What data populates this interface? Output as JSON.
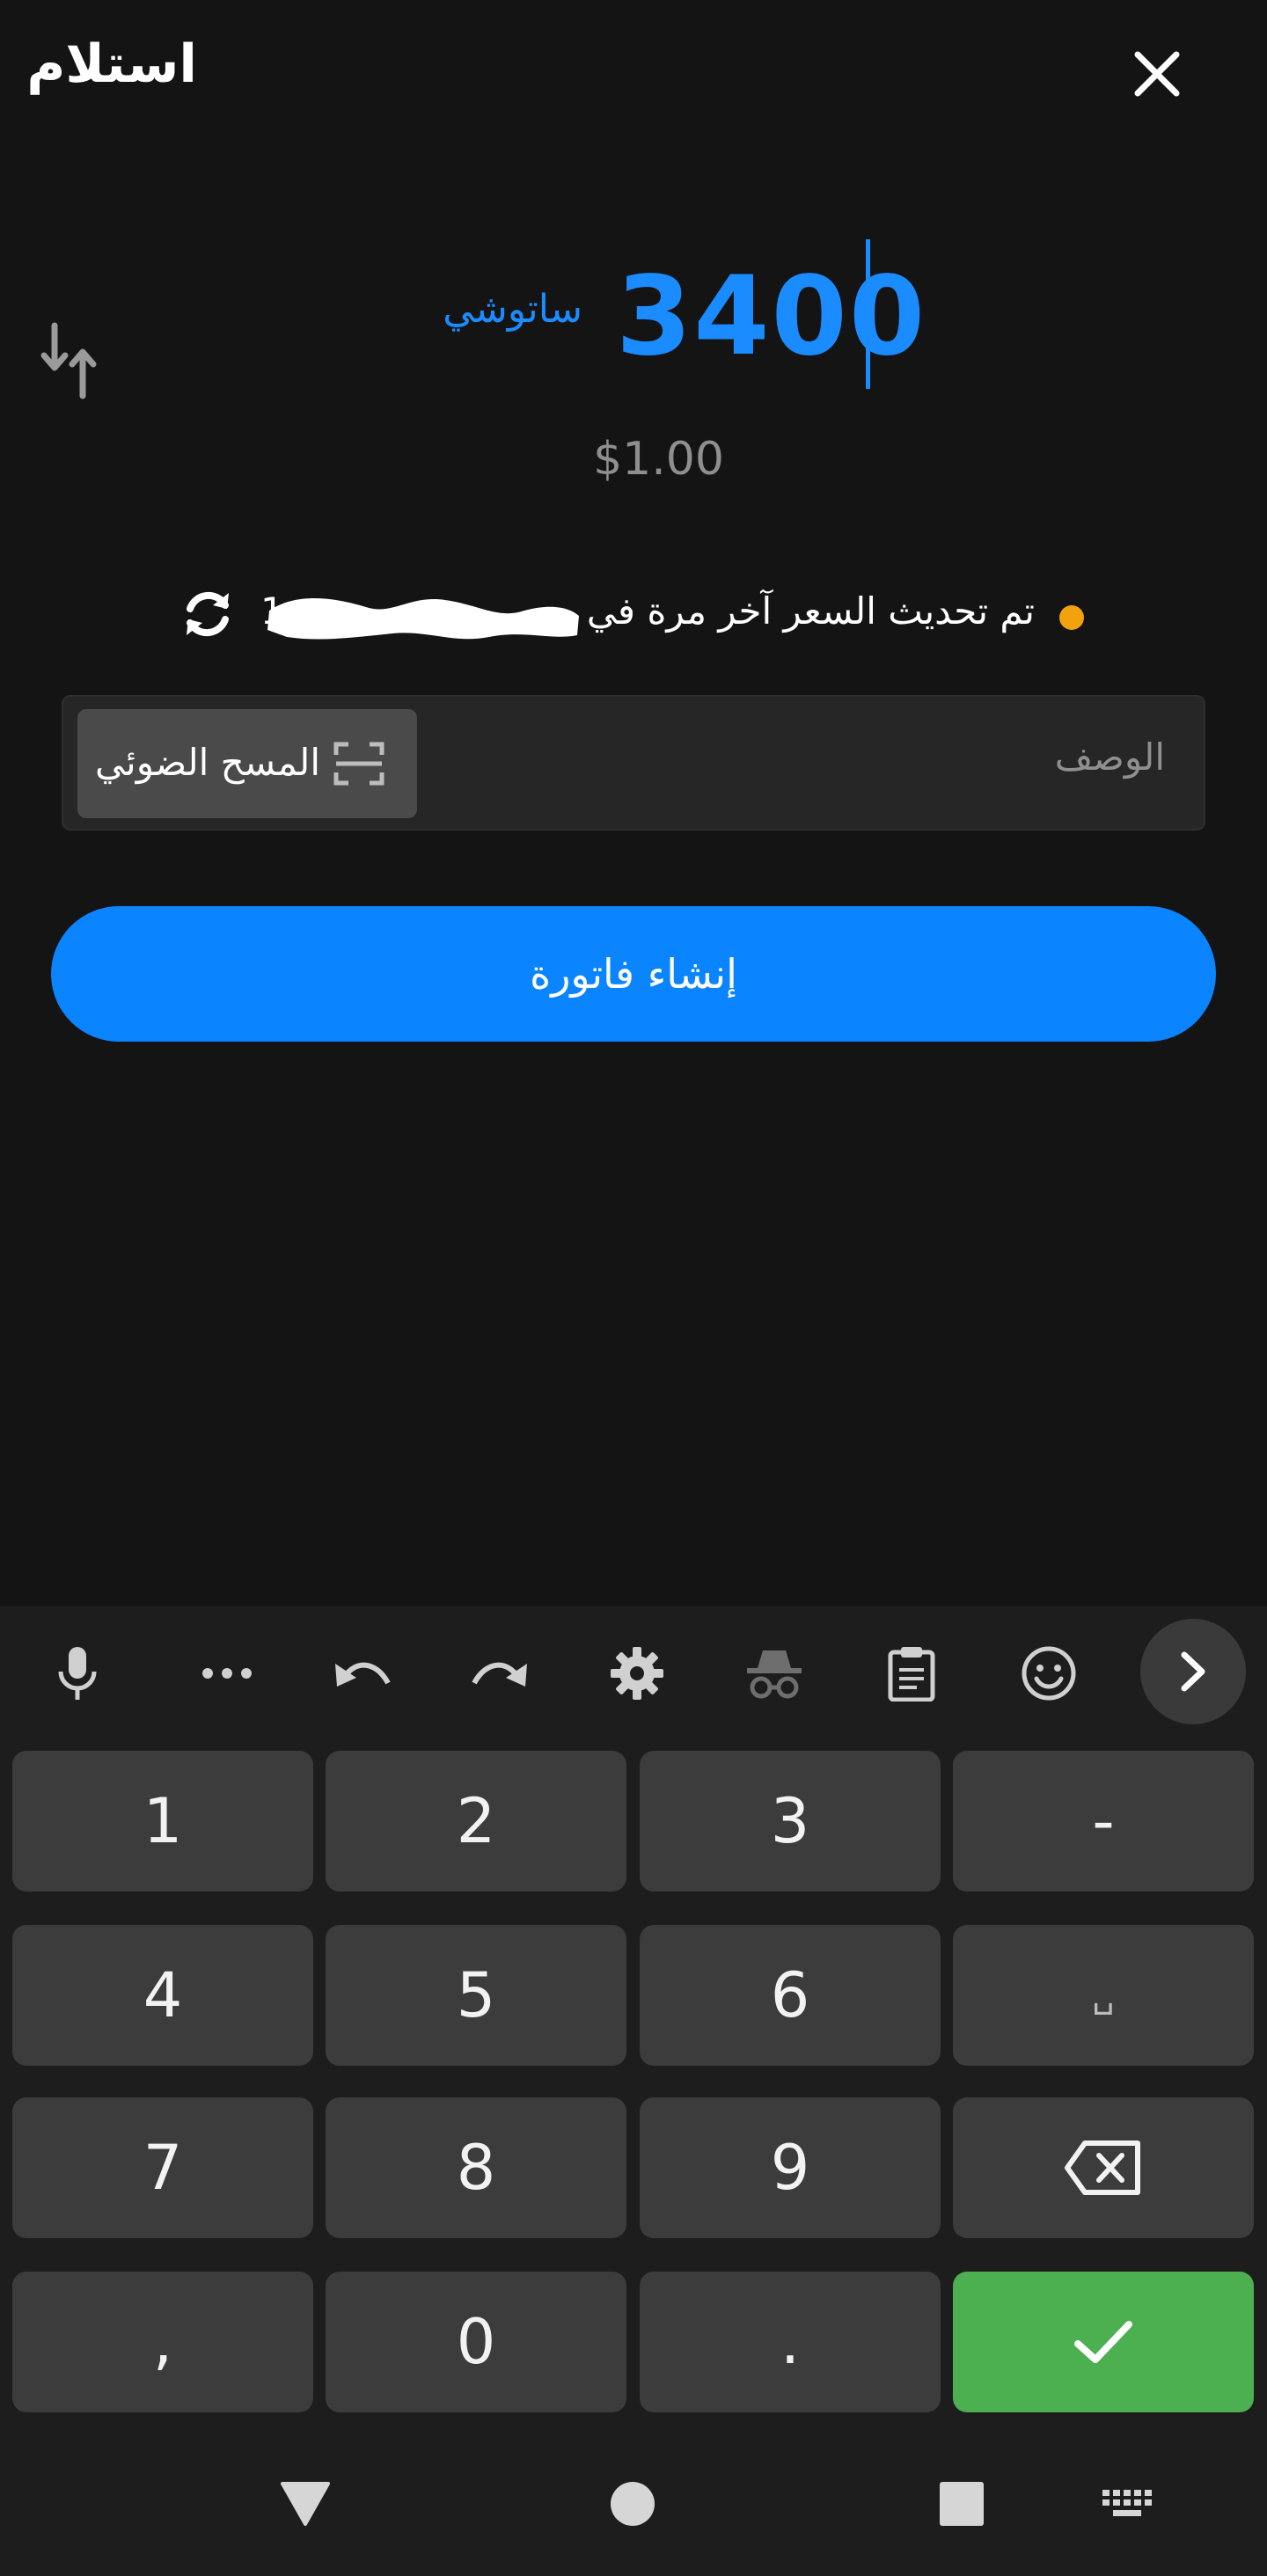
{
  "header": {
    "title": "استلام",
    "close_icon": "close-icon"
  },
  "amount": {
    "value": "3400",
    "unit": "ساتوشي",
    "fiat": "$1.00",
    "swap_icon": "swap-vertical-icon",
    "accent_color": "#1a8cff"
  },
  "rate": {
    "status_color": "#f2a20c",
    "text": "تم تحديث السعر آخر مرة في",
    "time": "1 ",
    "time_redacted": true,
    "refresh_icon": "refresh-icon"
  },
  "description": {
    "placeholder": "الوصف",
    "scan_label": "المسح الضوئي",
    "scan_icon": "scan-icon"
  },
  "invoice_button": {
    "label": "إنشاء فاتورة",
    "color": "#0a84ff"
  },
  "keyboard": {
    "toolbar": [
      "mic-icon",
      "more-icon",
      "undo-icon",
      "redo-icon",
      "settings-icon",
      "incognito-icon",
      "clipboard-icon",
      "emoji-icon",
      "next-icon"
    ],
    "rows": [
      [
        "1",
        "2",
        "3",
        "-"
      ],
      [
        "4",
        "5",
        "6",
        "␣"
      ],
      [
        "7",
        "8",
        "9",
        "⌫"
      ],
      [
        ",",
        "0",
        ".",
        "✓"
      ]
    ],
    "enter_color": "#4caf50"
  },
  "navbar": [
    "back-icon",
    "home-icon",
    "recents-icon",
    "keyboard-icon"
  ]
}
